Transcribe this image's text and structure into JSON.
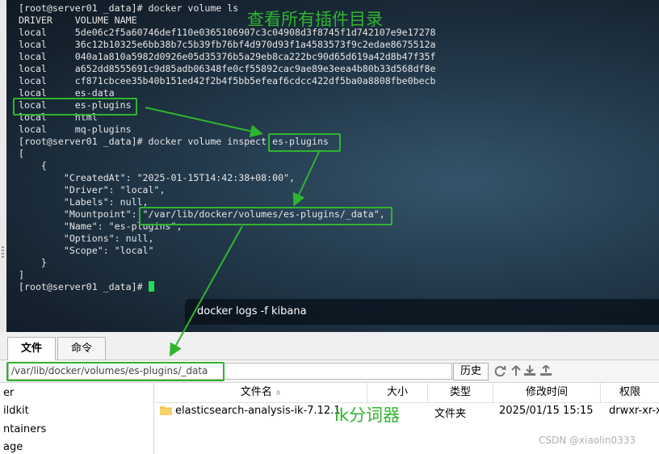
{
  "terminal": {
    "lines": [
      "[root@server01 _data]# docker volume ls",
      "DRIVER    VOLUME NAME",
      "local     5de06c2f5a60746def110e0365106907c3c04908d3f8745f1d742107e9e17278",
      "local     36c12b10325e6bb38b7c5b39fb76bf4d970d93f1a4583573f9c2edae8675512a",
      "local     040a1a810a5982d0926e05d35376b5a29eb8ca222bc90d65d619a42d8b47f35f",
      "local     a652dd8555691c9d85adb06348fe0cf55892cac9ae89e3eea4b80b33d568df8e",
      "local     cf871cbcee35b40b151ed42f2b4f5bb5efeaf6cdcc422df5ba0a8808fbe0becb",
      "local     es-data",
      "local     es-plugins",
      "local     html",
      "local     mq-plugins",
      "[root@server01 _data]# docker volume inspect es-plugins",
      "[",
      "    {",
      "        \"CreatedAt\": \"2025-01-15T14:42:38+08:00\",",
      "        \"Driver\": \"local\",",
      "        \"Labels\": null,",
      "        \"Mountpoint\": \"/var/lib/docker/volumes/es-plugins/_data\",",
      "        \"Name\": \"es-plugins\",",
      "        \"Options\": null,",
      "        \"Scope\": \"local\"",
      "    }",
      "]",
      "[root@server01 _data]# "
    ],
    "annotation": "查看所有插件目录",
    "popup_command": "docker logs -f kibana",
    "accent_color": "#2fb52f"
  },
  "tabs": [
    {
      "label": "文件",
      "active": true
    },
    {
      "label": "命令",
      "active": false
    }
  ],
  "pathbar": {
    "path": "/var/lib/docker/volumes/es-plugins/_data",
    "history_label": "历史",
    "icons": [
      "refresh-icon",
      "up-arrow-icon",
      "download-icon",
      "upload-icon"
    ]
  },
  "tree": {
    "items": [
      "er",
      "ildkit",
      "ntainers",
      "age"
    ]
  },
  "file_list": {
    "columns": [
      "文件名",
      "大小",
      "类型",
      "修改时间",
      "权限"
    ],
    "rows": [
      {
        "name": "elasticsearch-analysis-ik-7.12.1",
        "size": "",
        "type": "文件夹",
        "modified": "2025/01/15 15:15",
        "permissions": "drwxr-xr-x"
      }
    ],
    "annotation": "ik分词器"
  },
  "watermark": "CSDN @xiaolin0333"
}
